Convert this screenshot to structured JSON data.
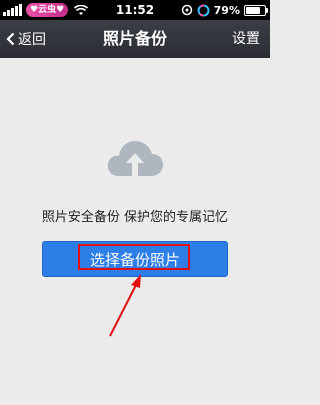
{
  "status_bar": {
    "carrier": "♥云虫♥",
    "time": "11:52",
    "battery_percent": "79%",
    "battery_level": 0.79
  },
  "nav": {
    "back_label": "返回",
    "title": "照片备份",
    "settings_label": "设置"
  },
  "main": {
    "icon": "cloud-upload-icon",
    "tagline": "照片安全备份 保护您的专属记忆",
    "select_button_label": "选择备份照片"
  },
  "colors": {
    "nav_bg": "#2b2d33",
    "page_bg": "#ebebeb",
    "button_blue": "#2d7ee6",
    "annotation_red": "#e01010",
    "cloud_gray": "#aeb6c0"
  }
}
